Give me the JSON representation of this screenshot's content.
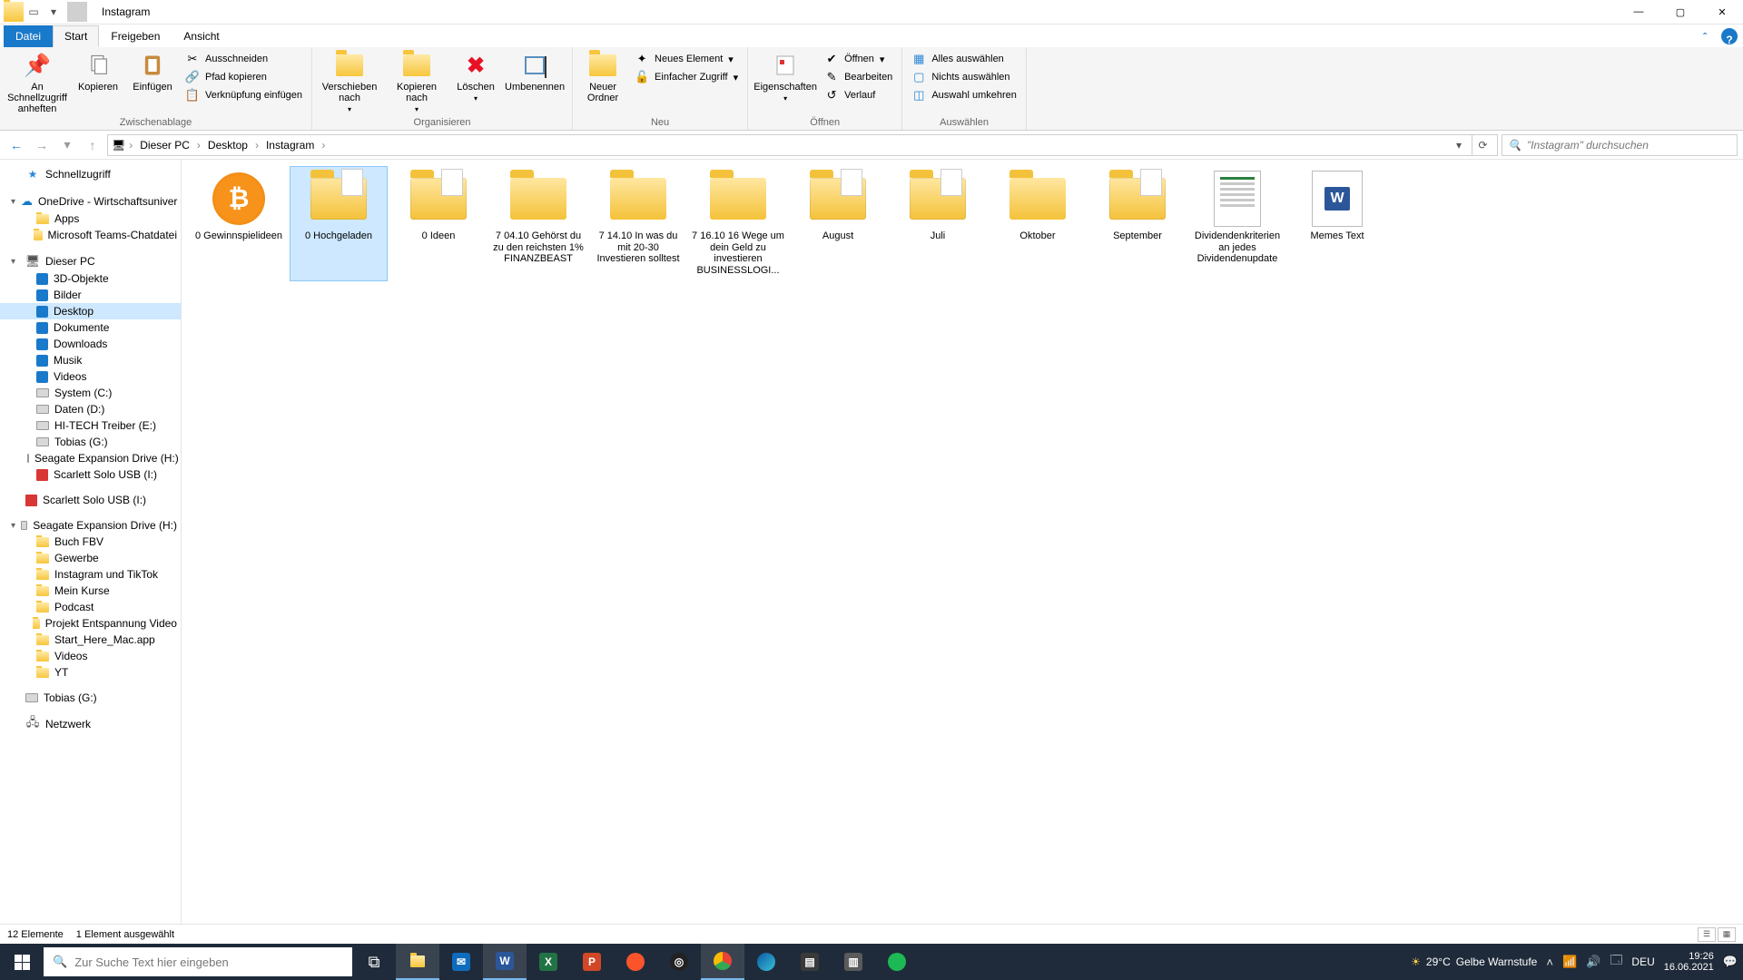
{
  "title": "Instagram",
  "tabs": {
    "file": "Datei",
    "start": "Start",
    "share": "Freigeben",
    "view": "Ansicht"
  },
  "ribbon": {
    "clipboard": {
      "label": "Zwischenablage",
      "pin": "An Schnellzugriff anheften",
      "copy": "Kopieren",
      "paste": "Einfügen",
      "cut": "Ausschneiden",
      "copypath": "Pfad kopieren",
      "pasteshortcut": "Verknüpfung einfügen"
    },
    "organize": {
      "label": "Organisieren",
      "moveto": "Verschieben nach",
      "copyto": "Kopieren nach",
      "delete": "Löschen",
      "rename": "Umbenennen"
    },
    "new": {
      "label": "Neu",
      "newfolder": "Neuer Ordner",
      "newitem": "Neues Element",
      "easyaccess": "Einfacher Zugriff"
    },
    "open": {
      "label": "Öffnen",
      "properties": "Eigenschaften",
      "open": "Öffnen",
      "edit": "Bearbeiten",
      "history": "Verlauf"
    },
    "select": {
      "label": "Auswählen",
      "selectall": "Alles auswählen",
      "selectnone": "Nichts auswählen",
      "invert": "Auswahl umkehren"
    }
  },
  "breadcrumb": {
    "pc": "Dieser PC",
    "desktop": "Desktop",
    "folder": "Instagram"
  },
  "search_placeholder": "\"Instagram\" durchsuchen",
  "sidebar": {
    "quick": "Schnellzugriff",
    "onedrive": "OneDrive - Wirtschaftsuniver",
    "apps": "Apps",
    "teams": "Microsoft Teams-Chatdatei",
    "thispc": "Dieser PC",
    "obj3d": "3D-Objekte",
    "pictures": "Bilder",
    "desktop": "Desktop",
    "documents": "Dokumente",
    "downloads": "Downloads",
    "music": "Musik",
    "videos": "Videos",
    "system": "System (C:)",
    "daten": "Daten (D:)",
    "hitech": "HI-TECH Treiber (E:)",
    "tobias1": "Tobias (G:)",
    "seagate1": "Seagate Expansion Drive (H:)",
    "scarlett1": "Scarlett Solo USB (I:)",
    "scarlett2": "Scarlett Solo USB (I:)",
    "seagate2": "Seagate Expansion Drive (H:)",
    "buchfbv": "Buch FBV",
    "gewerbe": "Gewerbe",
    "igtiktok": "Instagram und TikTok",
    "kurse": "Mein Kurse",
    "podcast": "Podcast",
    "projekt": "Projekt Entspannung Video",
    "startmac": "Start_Here_Mac.app",
    "videos2": "Videos",
    "yt": "YT",
    "tobias2": "Tobias (G:)",
    "network": "Netzwerk"
  },
  "items": {
    "i0": "0 Gewinnspielideen",
    "i1": "0 Hochgeladen",
    "i2": "0 Ideen",
    "i3": "7   04.10 Gehörst du zu den reichsten 1% FINANZBEAST",
    "i4": "7   14.10 In was du mit 20-30 Investieren solltest",
    "i5": "7   16.10 16 Wege um dein Geld zu investieren BUSINESSLOGI...",
    "i6": "August",
    "i7": "Juli",
    "i8": "Oktober",
    "i9": "September",
    "i10": "Dividendenkriterien an jedes Dividendenupdate",
    "i11": "Memes Text"
  },
  "status": {
    "count": "12 Elemente",
    "selected": "1 Element ausgewählt"
  },
  "taskbar": {
    "search": "Zur Suche Text hier eingeben",
    "weather_temp": "29°C",
    "weather_text": "Gelbe Warnstufe",
    "lang": "DEU",
    "time": "19:26",
    "date": "16.06.2021"
  }
}
